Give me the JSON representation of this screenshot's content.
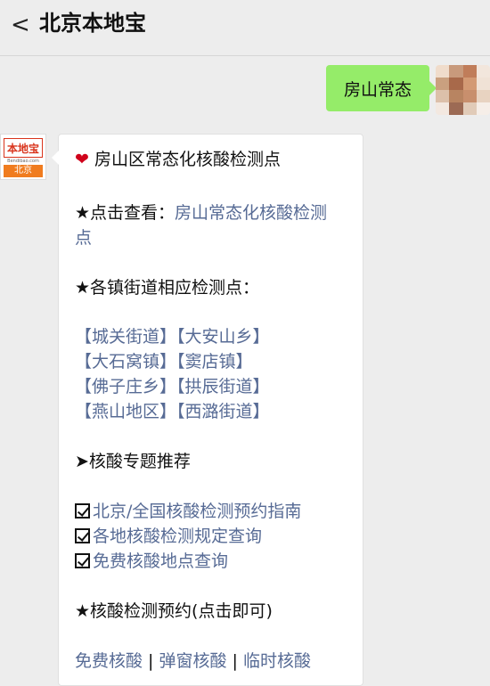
{
  "header": {
    "back_icon": "<",
    "title": "北京本地宝"
  },
  "outgoing": {
    "text": "房山常态"
  },
  "bot_avatar": {
    "logo_top": "本地宝",
    "logo_url": "Bendibao.com",
    "logo_bottom": "北京"
  },
  "message": {
    "heading_icon": "❤",
    "heading": "房山区常态化核酸检测点",
    "view_prefix": "★点击查看：",
    "view_link_line1": "房山常态化核酸检测",
    "view_link_line2": "点",
    "streets_heading": "★各镇街道相应检测点：",
    "street_rows": [
      [
        "【城关街道】",
        "【大安山乡】"
      ],
      [
        "【大石窝镇】",
        "【窦店镇】"
      ],
      [
        "【佛子庄乡】",
        "【拱辰街道】"
      ],
      [
        "【燕山地区】",
        "【西潞街道】"
      ]
    ],
    "recommend_heading": "➤核酸专题推荐",
    "recommend_links": [
      "北京/全国核酸检测预约指南",
      "各地核酸检测规定查询",
      "免费核酸地点查询"
    ],
    "booking_heading": "★核酸检测预约(点击即可)",
    "booking_links": [
      "免费核酸",
      "弹窗核酸",
      "临时核酸"
    ],
    "separator": " | "
  },
  "colors": {
    "link": "#576b95",
    "bubble_out": "#95ec69",
    "background": "#ededed"
  }
}
